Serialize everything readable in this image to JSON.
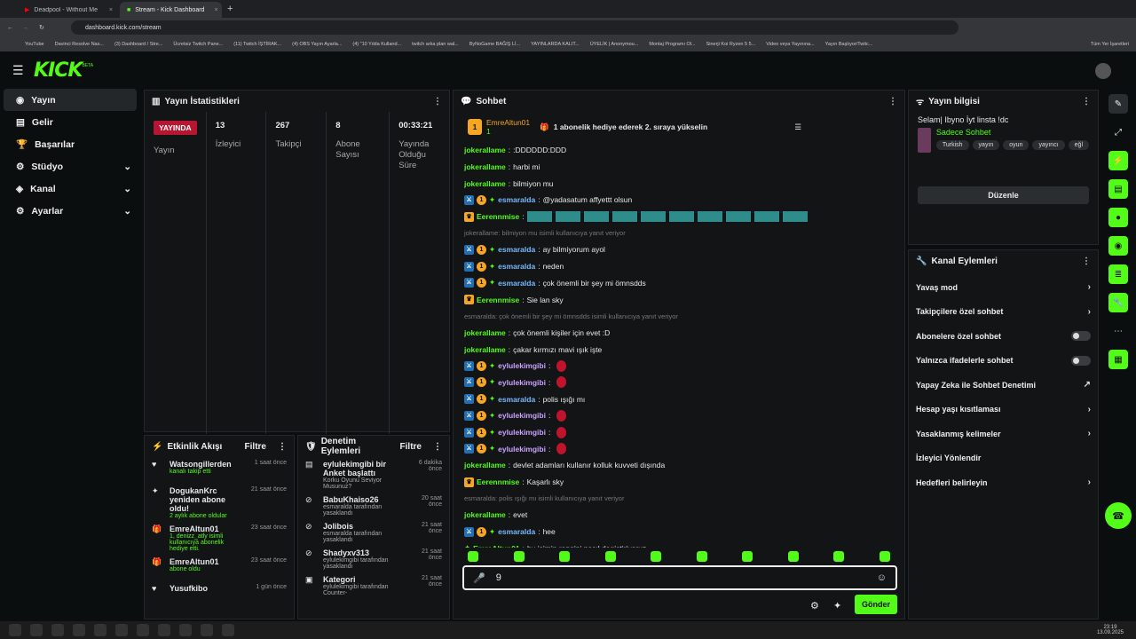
{
  "browser": {
    "tabs": [
      {
        "label": "Deadpool - Without Me (Emine..."
      },
      {
        "label": "Stream - Kick Dashboard"
      }
    ],
    "url": "dashboard.kick.com/stream",
    "bookmarks": [
      "YouTube",
      "Davinci Resolve Nas...",
      "(3) Dashboard / Stre...",
      "Ücretsiz Twitch Pane...",
      "(11) Twitch İŞTİRAK...",
      "(4) OBS Yayın Ayarla...",
      "(4) \"10 Yılda Kulland...",
      "twitch arka plan wal...",
      "ByNoGame BAĞIŞ Lİ...",
      "YAYINLARDA KALIT...",
      "ÜYELİK | Anonymou...",
      "Montaj Programı Ol...",
      "Sinerji Koi Ryzen 5 5...",
      "Video veya Yayınına...",
      "Yayın Başlıyor/Twitc..."
    ],
    "all_bookmarks": "Tüm Yer İşaretleri"
  },
  "header": {
    "logo": "KICK",
    "beta": "BETA"
  },
  "nav": [
    {
      "label": "Yayın",
      "icon": "broadcast-icon"
    },
    {
      "label": "Gelir",
      "icon": "money-icon"
    },
    {
      "label": "Başarılar",
      "icon": "trophy-icon"
    },
    {
      "label": "Stüdyo",
      "icon": "studio-icon"
    },
    {
      "label": "Kanal",
      "icon": "channel-icon"
    },
    {
      "label": "Ayarlar",
      "icon": "gear-icon"
    }
  ],
  "stats": {
    "title": "Yayın İstatistikleri",
    "live": "YAYINDA",
    "live_label": "Yayın",
    "items": [
      {
        "value": "13",
        "label": "İzleyici"
      },
      {
        "value": "267",
        "label": "Takipçi"
      },
      {
        "value": "8",
        "label": "Abone Sayısı"
      },
      {
        "value": "00:33:21",
        "label": "Yayında Olduğu Süre"
      }
    ]
  },
  "activity": {
    "title": "Etkinlik Akışı",
    "filter": "Filtre",
    "items": [
      {
        "name": "Watsongillerden",
        "desc": "kanalı takip etti",
        "time": "1 saat önce"
      },
      {
        "name": "DogukanKrc yeniden abone oldu!",
        "desc": "2 aylık abone oldular",
        "time": "21 saat önce"
      },
      {
        "name": "EmreAltun01",
        "desc": "1, denizz_atly isimli kullanıcıya abonelik hediye etti.",
        "time": "23 saat önce"
      },
      {
        "name": "EmreAltun01",
        "desc": "abone oldu",
        "time": "23 saat önce"
      },
      {
        "name": "Yusufkibo",
        "desc": "",
        "time": "1 gün önce"
      }
    ]
  },
  "moderation": {
    "title": "Denetim Eylemleri",
    "filter": "Filtre",
    "items": [
      {
        "name": "eylulekimgibi bir Anket başlattı",
        "desc": "Korku Oyunu Seviyor Musunuz?",
        "time": "6 dakika önce"
      },
      {
        "name": "BabuKhaiso26",
        "desc": "esmaralda tarafından yasaklandı",
        "time": "20 saat önce"
      },
      {
        "name": "Jolibois",
        "desc": "esmaralda tarafından yasaklandı",
        "time": "21 saat önce"
      },
      {
        "name": "Shadyxv313",
        "desc": "eylulekimgibi tarafından yasaklandı",
        "time": "21 saat önce"
      },
      {
        "name": "Kategori",
        "desc": "eylulekimgibi tarafından Counter-",
        "time": "21 saat önce"
      }
    ]
  },
  "chat": {
    "title": "Sohbet",
    "pinned_user": "EmreAltun01",
    "pinned_count": "1",
    "pinned_rank": "1",
    "pinned_text": "1 abonelik hediye ederek 2. sıraya yükselin",
    "messages": [
      {
        "user": "jokerallame",
        "text": ":DDDDDD:DDD",
        "cls": "g",
        "badges": ""
      },
      {
        "user": "jokerallame",
        "text": "harbi mi",
        "cls": "g",
        "badges": ""
      },
      {
        "user": "jokerallame",
        "text": "bilmiyon mu",
        "cls": "g",
        "badges": ""
      },
      {
        "user": "esmaralda",
        "text": "@yadasatum affyettt olsun",
        "cls": "b",
        "badges": "mod"
      },
      {
        "user": "Eerennmise",
        "text": "",
        "cls": "g",
        "badges": "og",
        "emotes": true
      },
      {
        "reply": "jokerallame: bilmiyon mu isimli kullanıcıya yanıt veriyor"
      },
      {
        "user": "esmaralda",
        "text": "ay bilmiyorum ayol",
        "cls": "b",
        "badges": "mod"
      },
      {
        "user": "esmaralda",
        "text": "neden",
        "cls": "b",
        "badges": "mod"
      },
      {
        "user": "esmaralda",
        "text": "çok önemli bir şey mi ömnsdds",
        "cls": "b",
        "badges": "mod"
      },
      {
        "user": "Eerennmise",
        "text": "Sie lan sky",
        "cls": "g",
        "badges": "og"
      },
      {
        "reply": "esmaralda: çok önemli bir şey mi ömnsdds isimli kullanıcıya yanıt veriyor"
      },
      {
        "user": "jokerallame",
        "text": "çok önemli kişiler için evet :D",
        "cls": "g",
        "badges": ""
      },
      {
        "user": "jokerallame",
        "text": "çakar kırmızı mavi ışık işte",
        "cls": "g",
        "badges": ""
      },
      {
        "user": "eylulekimgibi",
        "text": "",
        "cls": "p",
        "badges": "mod",
        "drop": true
      },
      {
        "user": "eylulekimgibi",
        "text": "",
        "cls": "p",
        "badges": "mod",
        "drop": true
      },
      {
        "user": "esmaralda",
        "text": "polis ışığı mı",
        "cls": "b",
        "badges": "mod"
      },
      {
        "user": "eylulekimgibi",
        "text": "",
        "cls": "p",
        "badges": "mod",
        "drop": true
      },
      {
        "user": "eylulekimgibi",
        "text": "",
        "cls": "p",
        "badges": "mod",
        "drop": true
      },
      {
        "user": "eylulekimgibi",
        "text": "",
        "cls": "p",
        "badges": "mod",
        "drop": true
      },
      {
        "user": "jokerallame",
        "text": "devlet adamları kullanır kolluk kuvveti dışında",
        "cls": "g",
        "badges": ""
      },
      {
        "user": "Eerennmise",
        "text": "Kaşarlı sky",
        "cls": "g",
        "badges": "og"
      },
      {
        "reply": "esmaralda: polis ışığı mı isimli kullanıcıya yanıt veriyor"
      },
      {
        "user": "jokerallame",
        "text": "evet",
        "cls": "g",
        "badges": ""
      },
      {
        "user": "esmaralda",
        "text": "hee",
        "cls": "b",
        "badges": "mod"
      },
      {
        "user": "EmreAltun01",
        "text": "bu isimin rengini nasıl degiştiriyoruz",
        "cls": "g",
        "badges": "sub"
      }
    ],
    "input_value": "9",
    "send": "Gönder"
  },
  "info": {
    "title": "Yayın bilgisi",
    "stream_title": "Selam| Ibyno İyt linsta !dc",
    "category": "Sadece Sohbet",
    "tags": [
      "Turkish",
      "yayın",
      "oyun",
      "yayıncı",
      "eğl"
    ],
    "edit": "Düzenle"
  },
  "actions": {
    "title": "Kanal Eylemleri",
    "items": [
      {
        "label": "Yavaş mod",
        "type": "chev"
      },
      {
        "label": "Takipçilere özel sohbet",
        "type": "chev"
      },
      {
        "label": "Abonelere özel sohbet",
        "type": "toggle"
      },
      {
        "label": "Yalnızca ifadelerle sohbet",
        "type": "toggle"
      },
      {
        "label": "Yapay Zeka ile Sohbet Denetimi",
        "type": "ext"
      },
      {
        "label": "Hesap yaşı kısıtlaması",
        "type": "chev"
      },
      {
        "label": "Yasaklanmış kelimeler",
        "type": "chev"
      },
      {
        "label": "İzleyici Yönlendir",
        "type": "none"
      },
      {
        "label": "Hedefleri belirleyin",
        "type": "chev"
      }
    ]
  },
  "clock": {
    "time": "23:19",
    "date": "13.09.2025"
  }
}
